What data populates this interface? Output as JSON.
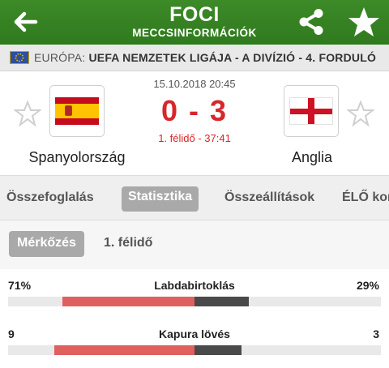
{
  "header": {
    "title": "FOCI",
    "subtitle": "MECCSINFORMÁCIÓK"
  },
  "icons": {
    "back": "arrow-left-icon",
    "share": "share-icon",
    "favorite": "star-icon"
  },
  "competition": {
    "region": "EURÓPA:",
    "name": "UEFA NEMZETEK LIGÁJA - A DIVÍZIÓ - 4. FORDULÓ",
    "flag": "europe-flag-icon"
  },
  "match": {
    "datetime": "15.10.2018 20:45",
    "score": "0 - 3",
    "status": "1. félidő - 37:41",
    "home": {
      "name": "Spanyolország",
      "flag": "spain-flag"
    },
    "away": {
      "name": "Anglia",
      "flag": "england-flag"
    }
  },
  "tabs": [
    {
      "label": "Összefoglalás",
      "active": false
    },
    {
      "label": "Statisztika",
      "active": true
    },
    {
      "label": "Összeállítások",
      "active": false
    },
    {
      "label": "ÉLŐ kom",
      "active": false
    }
  ],
  "subtabs": [
    {
      "label": "Mérkőzés",
      "active": true
    },
    {
      "label": "1. félidő",
      "active": false
    }
  ],
  "stats": [
    {
      "label": "Labdabirtoklás",
      "home": "71%",
      "away": "29%",
      "home_share": 0.71,
      "away_share": 0.29
    },
    {
      "label": "Kapura lövés",
      "home": "9",
      "away": "3",
      "home_share": 0.75,
      "away_share": 0.25
    }
  ],
  "colors": {
    "header_green": "#2f7a1e",
    "score_red": "#d8272b",
    "home_bar": "#e06060",
    "away_bar": "#4a4a4a",
    "tab_active_bg": "#a9a9a9"
  }
}
